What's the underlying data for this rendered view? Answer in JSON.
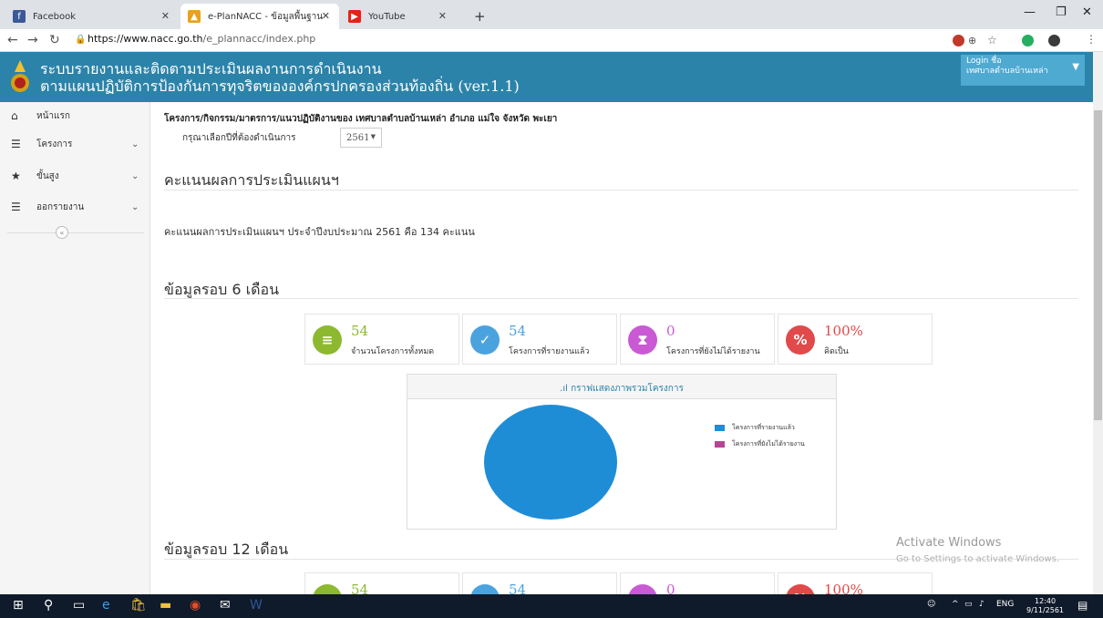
{
  "browser": {
    "tabs": [
      {
        "title": "Facebook"
      },
      {
        "title": "e-PlanNACC - ข้อมูลพื้นฐาน"
      },
      {
        "title": "YouTube"
      }
    ],
    "new_tab": "+",
    "url_host": "https://www.nacc.go.th",
    "url_path": "/e_plannacc/index.php"
  },
  "header": {
    "title_line1": "ระบบรายงานและติดตามประเมินผลงานการดำเนินงาน",
    "title_line2": "ตามแผนปฏิบัติการป้องกันการทุจริตขององค์กรปกครองส่วนท้องถิ่น (ver.1.1)",
    "login_line1": "Login ชื่อ",
    "login_line2": "เทศบาลตำบลบ้านเหล่า"
  },
  "sidebar": {
    "items": [
      {
        "label": "หน้าแรก",
        "icon": "home-icon"
      },
      {
        "label": "โครงการ",
        "icon": "list-icon"
      },
      {
        "label": "ขั้นสูง",
        "icon": "star-icon"
      },
      {
        "label": "ออกรายงาน",
        "icon": "list-icon"
      }
    ],
    "collapse": "«"
  },
  "main": {
    "project_line": "โครงการ/กิจกรรม/มาตรการ/แนวปฏิบัติงานของ เทศบาลตำบลบ้านเหล่า อำเภอ แม่ใจ จังหวัด พะเยา",
    "year_label": "กรุณาเลือกปีที่ต้องดำเนินการ",
    "year_value": "2561",
    "score_heading": "คะแนนผลการประเมินแผนฯ",
    "score_text": "คะแนนผลการประเมินแผนฯ ประจำปีงบประมาณ 2561 คือ 134 คะแนน",
    "six_month_heading": "ข้อมูลรอบ 6 เดือน",
    "twelve_month_heading": "ข้อมูลรอบ 12 เดือน",
    "stats": [
      {
        "value": "54",
        "label": "จำนวนโครงการทั้งหมด",
        "color": "#8cb930",
        "icon": "database-icon"
      },
      {
        "value": "54",
        "label": "โครงการที่รายงานแล้ว",
        "color": "#4aa3df",
        "icon": "check-circle-icon"
      },
      {
        "value": "0",
        "label": "โครงการที่ยังไม่ได้รายงาน",
        "color": "#c95ad4",
        "icon": "hourglass-icon"
      },
      {
        "value": "100%",
        "label": "คิดเป็น",
        "color": "#e04a4a",
        "icon": "percent-icon"
      }
    ],
    "stats12": [
      {
        "value": "54"
      },
      {
        "value": "54"
      },
      {
        "value": "0"
      },
      {
        "value": "100%"
      }
    ],
    "chart_title": "กราฟแสดงภาพรวมโครงการ"
  },
  "chart_data": {
    "type": "pie",
    "title": "กราฟแสดงภาพรวมโครงการ",
    "categories": [
      "โครงการที่รายงานแล้ว",
      "โครงการที่ยังไม่ได้รายงาน"
    ],
    "values": [
      54,
      0
    ],
    "colors": [
      "#1f8dd6",
      "#b44595"
    ],
    "legend_position": "right"
  },
  "watermark": {
    "line1": "Activate Windows",
    "line2": "Go to Settings to activate Windows."
  },
  "taskbar": {
    "lang": "ENG",
    "time": "12:40",
    "date": "9/11/2561"
  }
}
